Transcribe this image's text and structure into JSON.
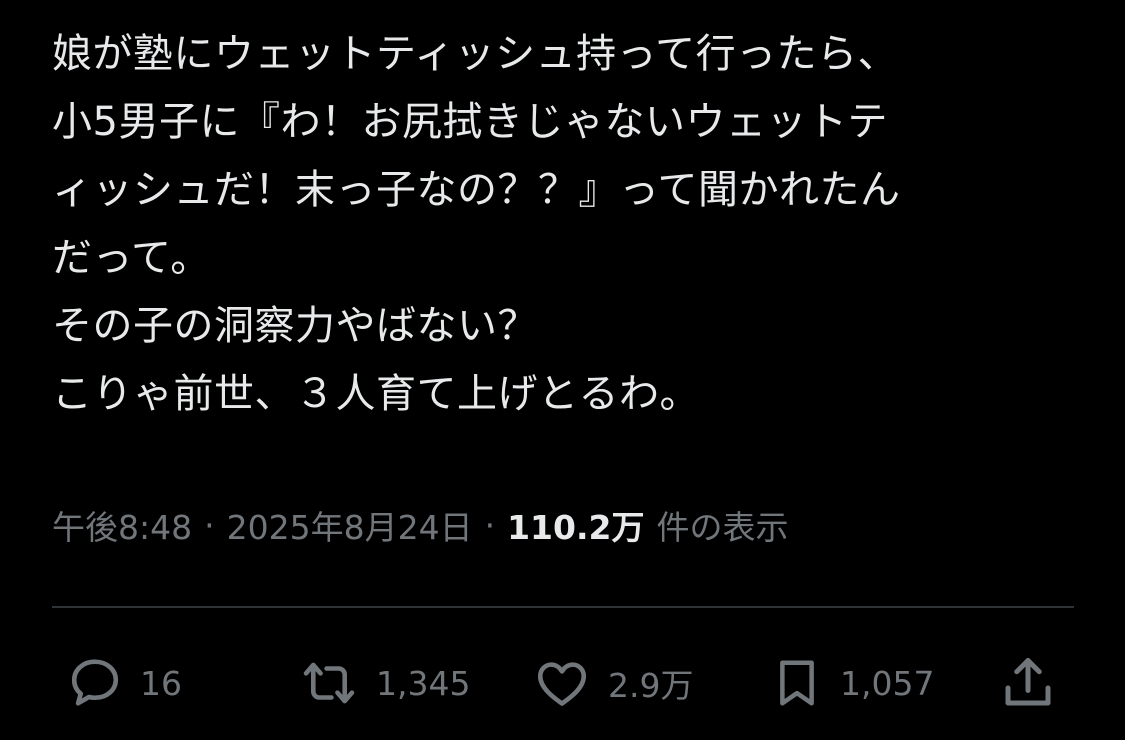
{
  "tweet": {
    "lines": [
      "娘が塾にウェットティッシュ持って行ったら、",
      "小5男子に『わ！お尻拭きじゃないウェットテ",
      "ィッシュだ！末っ子なの？？』って聞かれたん",
      "だって。",
      "その子の洞察力やばない？",
      "こりゃ前世、３人育て上げとるわ。"
    ]
  },
  "meta": {
    "time": "午後8:48",
    "separator": "·",
    "date": "2025年8月24日",
    "views_count": "110.2万",
    "views_label": "件の表示"
  },
  "actions": {
    "reply_count": "16",
    "retweet_count": "1,345",
    "like_count": "2.9万",
    "bookmark_count": "1,057"
  },
  "colors": {
    "background": "#000000",
    "text_primary": "#e7e9ea",
    "text_secondary": "#71767b",
    "divider": "#2f3336"
  }
}
